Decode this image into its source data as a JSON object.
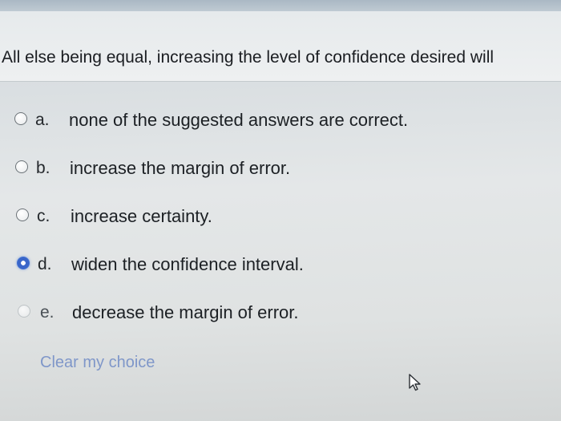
{
  "question": {
    "text": "All else being equal, increasing the level of confidence desired will"
  },
  "options": [
    {
      "letter": "a.",
      "text": "none of the suggested answers are correct.",
      "selected": false
    },
    {
      "letter": "b.",
      "text": "increase the margin of error.",
      "selected": false
    },
    {
      "letter": "c.",
      "text": "increase certainty.",
      "selected": false
    },
    {
      "letter": "d.",
      "text": "widen the confidence interval.",
      "selected": true
    },
    {
      "letter": "e.",
      "text": "decrease the margin of error.",
      "selected": false
    }
  ],
  "clear_choice_label": "Clear my choice",
  "colors": {
    "selected_radio": "#3a66c9",
    "link": "#7f97c9"
  },
  "icons": {
    "cursor": "mouse-pointer-icon"
  }
}
